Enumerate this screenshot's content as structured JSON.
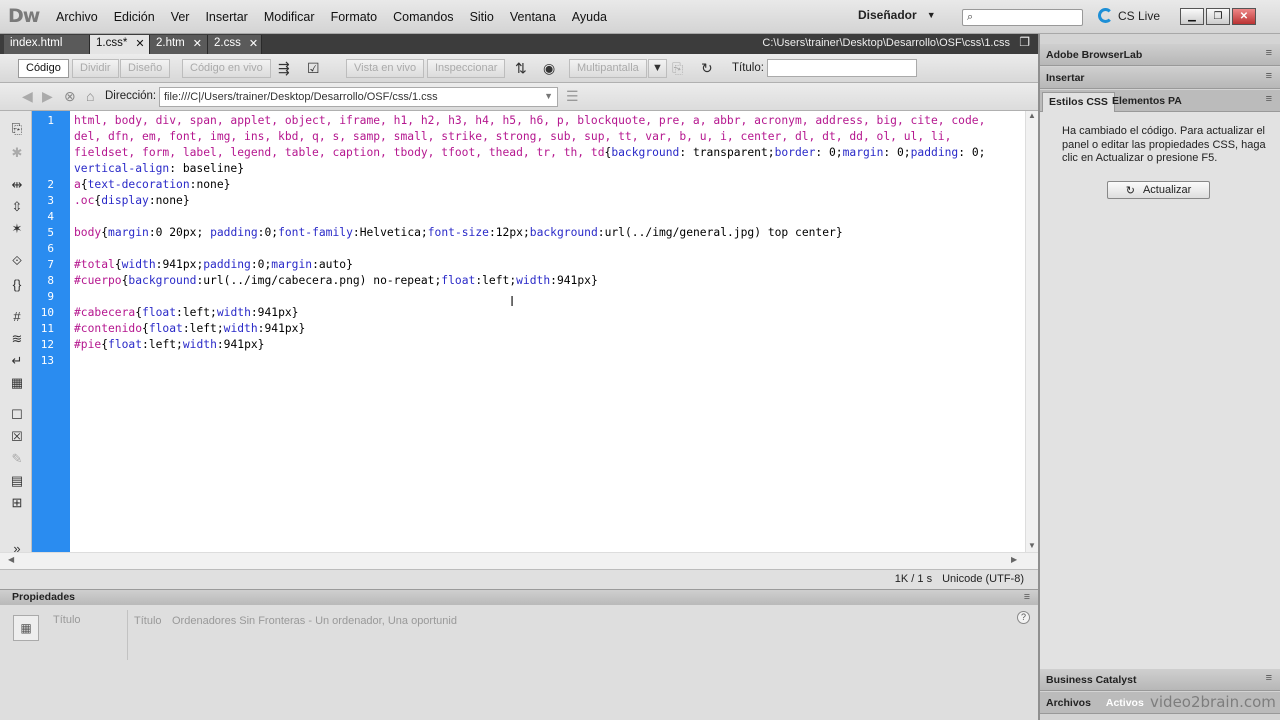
{
  "app": {
    "logo": "Dw"
  },
  "menu": [
    "Archivo",
    "Edición",
    "Ver",
    "Insertar",
    "Modificar",
    "Formato",
    "Comandos",
    "Sitio",
    "Ventana",
    "Ayuda"
  ],
  "workspace": {
    "label": "Diseñador"
  },
  "search": {
    "placeholder": ""
  },
  "cslive": {
    "label": "CS Live"
  },
  "tabs": [
    {
      "label": "index.html",
      "active": false
    },
    {
      "label": "1.css*",
      "active": true
    },
    {
      "label": "2.htm",
      "active": false
    },
    {
      "label": "2.css",
      "active": false
    }
  ],
  "filepath": "C:\\Users\\trainer\\Desktop\\Desarrollo\\OSF\\css\\1.css",
  "doc_toolbar": {
    "code": "Código",
    "split": "Dividir",
    "design": "Diseño",
    "live_code": "Código en vivo",
    "live_view": "Vista en vivo",
    "inspect": "Inspeccionar",
    "multiscreen": "Multipantalla",
    "title_label": "Título:",
    "title_value": ""
  },
  "address": {
    "label": "Dirección:",
    "value": "file:///C|/Users/trainer/Desktop/Desarrollo/OSF/css/1.css"
  },
  "code_lines": [
    {
      "n": "1",
      "tokens": [
        [
          "sel",
          "html, body, div, span, applet, object, iframe, h1, h2, h3, h4, h5, h6, p, blockquote, pre, a, abbr, acronym, address, big, cite, code,"
        ]
      ]
    },
    {
      "n": "",
      "tokens": [
        [
          "sel",
          "del, dfn, em, font, img, ins, kbd, q, s, samp, small, strike, strong, sub, sup, tt, var, b, u, i, center, dl, dt, dd, ol, ul, li,"
        ]
      ]
    },
    {
      "n": "",
      "tokens": [
        [
          "sel",
          "fieldset, form, label, legend, table, caption, tbody, tfoot, thead, tr, th, td"
        ],
        [
          "pv",
          "{"
        ],
        [
          "pn",
          "background"
        ],
        [
          "pv",
          ": transparent;"
        ],
        [
          "pn",
          "border"
        ],
        [
          "pv",
          ": 0;"
        ],
        [
          "pn",
          "margin"
        ],
        [
          "pv",
          ": 0;"
        ],
        [
          "pn",
          "padding"
        ],
        [
          "pv",
          ": 0;"
        ]
      ]
    },
    {
      "n": "",
      "tokens": [
        [
          "pn",
          "vertical-align"
        ],
        [
          "pv",
          ": baseline}"
        ]
      ]
    },
    {
      "n": "2",
      "tokens": [
        [
          "sel",
          "a"
        ],
        [
          "pv",
          "{"
        ],
        [
          "pn",
          "text-decoration"
        ],
        [
          "pv",
          ":none}"
        ]
      ]
    },
    {
      "n": "3",
      "tokens": [
        [
          "sel",
          ".oc"
        ],
        [
          "pv",
          "{"
        ],
        [
          "pn",
          "display"
        ],
        [
          "pv",
          ":none}"
        ]
      ]
    },
    {
      "n": "4",
      "tokens": []
    },
    {
      "n": "5",
      "tokens": [
        [
          "sel",
          "body"
        ],
        [
          "pv",
          "{"
        ],
        [
          "pn",
          "margin"
        ],
        [
          "pv",
          ":0 20px; "
        ],
        [
          "pn",
          "padding"
        ],
        [
          "pv",
          ":0;"
        ],
        [
          "pn",
          "font-family"
        ],
        [
          "pv",
          ":Helvetica;"
        ],
        [
          "pn",
          "font-size"
        ],
        [
          "pv",
          ":12px;"
        ],
        [
          "pn",
          "background"
        ],
        [
          "pv",
          ":url(../img/general.jpg) top center}"
        ]
      ]
    },
    {
      "n": "6",
      "tokens": []
    },
    {
      "n": "7",
      "tokens": [
        [
          "sel",
          "#total"
        ],
        [
          "pv",
          "{"
        ],
        [
          "pn",
          "width"
        ],
        [
          "pv",
          ":941px;"
        ],
        [
          "pn",
          "padding"
        ],
        [
          "pv",
          ":0;"
        ],
        [
          "pn",
          "margin"
        ],
        [
          "pv",
          ":auto}"
        ]
      ]
    },
    {
      "n": "8",
      "tokens": [
        [
          "sel",
          "#cuerpo"
        ],
        [
          "pv",
          "{"
        ],
        [
          "pn",
          "background"
        ],
        [
          "pv",
          ":url(../img/cabecera.png) no-repeat;"
        ],
        [
          "pn",
          "float"
        ],
        [
          "pv",
          ":left;"
        ],
        [
          "pn",
          "width"
        ],
        [
          "pv",
          ":941px}"
        ]
      ]
    },
    {
      "n": "9",
      "tokens": []
    },
    {
      "n": "10",
      "tokens": [
        [
          "sel",
          "#cabecera"
        ],
        [
          "pv",
          "{"
        ],
        [
          "pn",
          "float"
        ],
        [
          "pv",
          ":left;"
        ],
        [
          "pn",
          "width"
        ],
        [
          "pv",
          ":941px}"
        ]
      ]
    },
    {
      "n": "11",
      "tokens": [
        [
          "sel",
          "#contenido"
        ],
        [
          "pv",
          "{"
        ],
        [
          "pn",
          "float"
        ],
        [
          "pv",
          ":left;"
        ],
        [
          "pn",
          "width"
        ],
        [
          "pv",
          ":941px}"
        ]
      ]
    },
    {
      "n": "12",
      "tokens": [
        [
          "sel",
          "#pie"
        ],
        [
          "pv",
          "{"
        ],
        [
          "pn",
          "float"
        ],
        [
          "pv",
          ":left;"
        ],
        [
          "pn",
          "width"
        ],
        [
          "pv",
          ":941px}"
        ]
      ]
    },
    {
      "n": "13",
      "tokens": []
    }
  ],
  "status": {
    "size": "1K / 1 s",
    "encoding": "Unicode (UTF-8)"
  },
  "properties": {
    "header": "Propiedades",
    "title_label_left": "Título",
    "title_label": "Título",
    "title_value": "Ordenadores Sin Fronteras - Un ordenador, Una oportunid"
  },
  "right_panel": {
    "browserlab": "Adobe BrowserLab",
    "insert": "Insertar",
    "css_tab": "Estilos CSS",
    "ap_tab": "Elementos PA",
    "message": "Ha cambiado el código. Para actualizar el panel o editar las propiedades CSS, haga clic en Actualizar o presione F5.",
    "update_button": "Actualizar",
    "business_catalyst": "Business Catalyst",
    "files_tab": "Archivos",
    "assets_tab": "Activos"
  },
  "watermark": "video2brain.com"
}
